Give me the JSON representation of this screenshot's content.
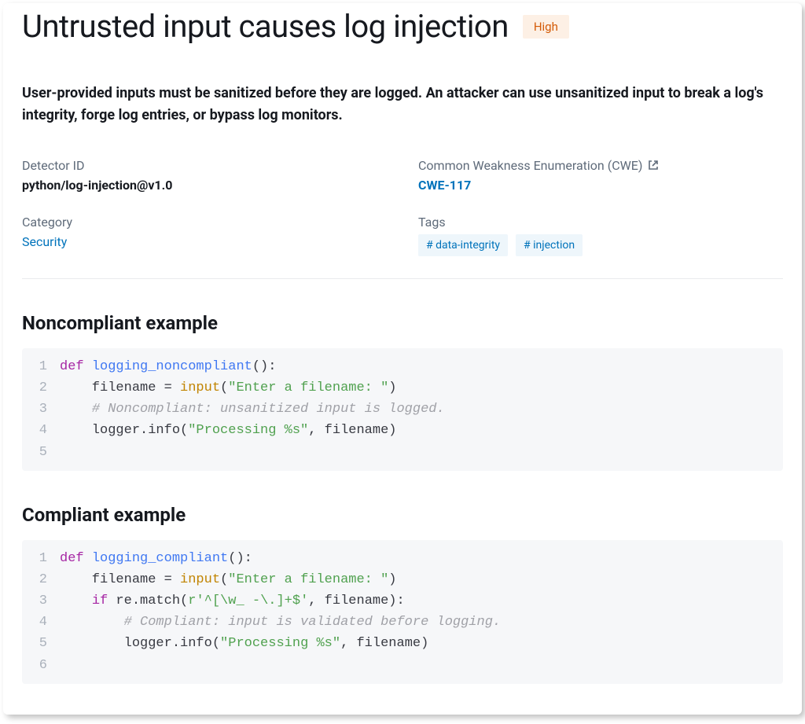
{
  "header": {
    "title": "Untrusted input causes log injection",
    "severity": "High"
  },
  "description": "User-provided inputs must be sanitized before they are logged. An attacker can use unsanitized input to break a log's integrity, forge log entries, or bypass log monitors.",
  "meta": {
    "detector_id_label": "Detector ID",
    "detector_id": "python/log-injection@v1.0",
    "cwe_label": "Common Weakness Enumeration (CWE)",
    "cwe_link": "CWE-117",
    "category_label": "Category",
    "category": "Security",
    "tags_label": "Tags",
    "tags": [
      "data-integrity",
      "injection"
    ]
  },
  "examples": {
    "noncompliant": {
      "heading": "Noncompliant example",
      "code": [
        [
          {
            "t": "kw",
            "v": "def"
          },
          {
            "t": "txt",
            "v": " "
          },
          {
            "t": "fn",
            "v": "logging_noncompliant"
          },
          {
            "t": "txt",
            "v": "():"
          }
        ],
        [
          {
            "t": "txt",
            "v": "    filename = "
          },
          {
            "t": "bi",
            "v": "input"
          },
          {
            "t": "txt",
            "v": "("
          },
          {
            "t": "str",
            "v": "\"Enter a filename: \""
          },
          {
            "t": "txt",
            "v": ")"
          }
        ],
        [
          {
            "t": "txt",
            "v": "    "
          },
          {
            "t": "cm",
            "v": "# Noncompliant: unsanitized input is logged."
          }
        ],
        [
          {
            "t": "txt",
            "v": "    logger.info("
          },
          {
            "t": "str",
            "v": "\"Processing %s\""
          },
          {
            "t": "txt",
            "v": ", filename)"
          }
        ],
        []
      ]
    },
    "compliant": {
      "heading": "Compliant example",
      "code": [
        [
          {
            "t": "kw",
            "v": "def"
          },
          {
            "t": "txt",
            "v": " "
          },
          {
            "t": "fn",
            "v": "logging_compliant"
          },
          {
            "t": "txt",
            "v": "():"
          }
        ],
        [
          {
            "t": "txt",
            "v": "    filename = "
          },
          {
            "t": "bi",
            "v": "input"
          },
          {
            "t": "txt",
            "v": "("
          },
          {
            "t": "str",
            "v": "\"Enter a filename: \""
          },
          {
            "t": "txt",
            "v": ")"
          }
        ],
        [
          {
            "t": "txt",
            "v": "    "
          },
          {
            "t": "kw",
            "v": "if"
          },
          {
            "t": "txt",
            "v": " re.match("
          },
          {
            "t": "str",
            "v": "r'^[\\w_ -\\.]+$'"
          },
          {
            "t": "txt",
            "v": ", filename):"
          }
        ],
        [
          {
            "t": "txt",
            "v": "        "
          },
          {
            "t": "cm",
            "v": "# Compliant: input is validated before logging."
          }
        ],
        [
          {
            "t": "txt",
            "v": "        logger.info("
          },
          {
            "t": "str",
            "v": "\"Processing %s\""
          },
          {
            "t": "txt",
            "v": ", filename)"
          }
        ],
        []
      ]
    }
  }
}
